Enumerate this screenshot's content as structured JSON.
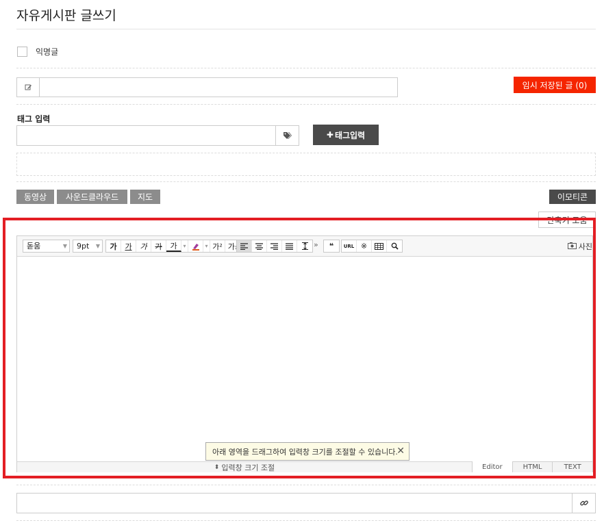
{
  "page": {
    "title": "자유게시판 글쓰기"
  },
  "anonymous": {
    "label": "익명글",
    "checked": false
  },
  "subject": {
    "value": "",
    "placeholder": ""
  },
  "temp_saved": {
    "label": "임시 저장된 글 (0)"
  },
  "tags": {
    "label": "태그 입력",
    "value": "",
    "button_label": "태그입력"
  },
  "media": {
    "video": "동영상",
    "soundcloud": "사운드클라우드",
    "map": "지도",
    "emoticon": "이모티콘"
  },
  "editor": {
    "alt_button": "단축키 도움",
    "font_family": "돋움",
    "font_size": "9pt",
    "format_buttons": [
      "가",
      "가",
      "가",
      "가",
      "가"
    ],
    "script_buttons": [
      "가²",
      "가₁"
    ],
    "align_buttons": [
      "align-left",
      "align-center",
      "align-right",
      "align-justify",
      "line-height"
    ],
    "insert_buttons": [
      "URL",
      "※",
      "table",
      "search"
    ],
    "photo_label": "사진",
    "resize_label": "입력창 크기 조절",
    "tip_text": "아래 영역을 드래그하여 입력창 크기를 조절할 수 있습니다.",
    "tabs": [
      "Editor",
      "HTML",
      "TEXT"
    ],
    "active_tab": "Editor"
  },
  "link": {
    "value": ""
  },
  "colors": {
    "accent_red": "#f52500",
    "dark_button": "#4a4a4a",
    "gray_button": "#8c8c8c",
    "highlight": "#e31e24"
  }
}
